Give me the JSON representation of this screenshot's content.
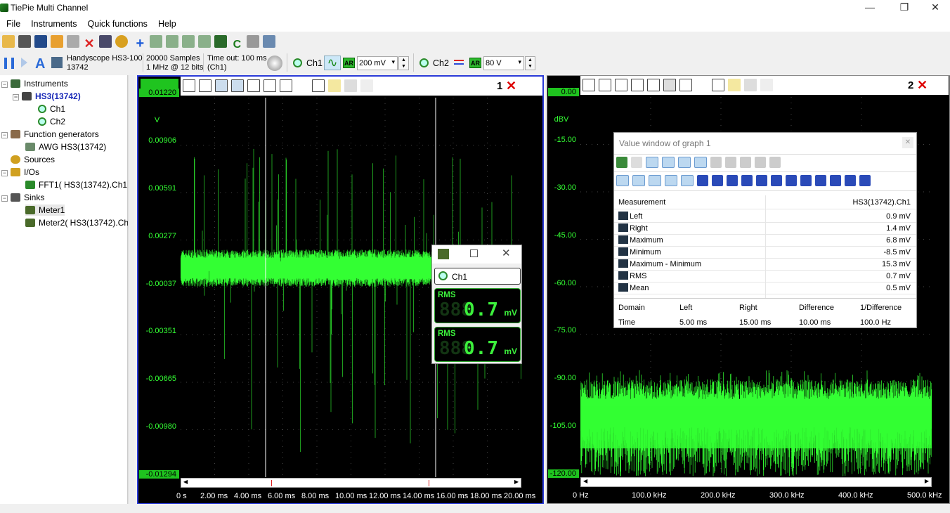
{
  "window": {
    "title": "TiePie Multi Channel",
    "min": "—",
    "max": "❐",
    "close": "✕"
  },
  "menu": [
    "File",
    "Instruments",
    "Quick functions",
    "Help"
  ],
  "toolbar2": {
    "instrument_line1": "Handyscope HS3-100",
    "instrument_line2": "13742",
    "samples_line1": "20000 Samples",
    "samples_line2": "1 MHz @ 12 bits",
    "timeout_line1": "Time out: 100 ms",
    "timeout_line2": "(Ch1)",
    "ch1_label": "Ch1",
    "ch1_range": "200 mV",
    "ch2_label": "Ch2",
    "ch2_range": "80 V",
    "ar": "AR"
  },
  "tree": {
    "instruments": "Instruments",
    "device": "HS3(13742)",
    "ch1": "Ch1",
    "ch2": "Ch2",
    "function_generators": "Function generators",
    "awg": "AWG HS3(13742)",
    "sources": "Sources",
    "ios": "I/Os",
    "fft": "FFT1( HS3(13742).Ch1 )",
    "sinks": "Sinks",
    "meter1": "Meter1",
    "meter2": "Meter2( HS3(13742).Ch1"
  },
  "graph1": {
    "number": "1",
    "unit": "V",
    "y_labels": [
      "0.01220",
      "0.00906",
      "0.00591",
      "0.00277",
      "-0.00037",
      "-0.00351",
      "-0.00665",
      "-0.00980",
      "-0.01294"
    ],
    "x_labels": [
      "0 s",
      "2.00 ms",
      "4.00 ms",
      "6.00 ms",
      "8.00 ms",
      "10.00 ms",
      "12.00 ms",
      "14.00 ms",
      "16.00 ms",
      "18.00 ms",
      "20.00 ms"
    ]
  },
  "graph2": {
    "number": "2",
    "unit": "dBV",
    "y_labels": [
      "0.00",
      "-15.00",
      "-30.00",
      "-45.00",
      "-60.00",
      "-75.00",
      "-90.00",
      "-105.00",
      "-120.00"
    ],
    "x_labels": [
      "0 Hz",
      "100.0 kHz",
      "200.0 kHz",
      "300.0 kHz",
      "400.0 kHz",
      "500.0 kHz"
    ]
  },
  "meter": {
    "channel": "Ch1",
    "rows": [
      {
        "label": "RMS",
        "ghost": "888",
        "value": "0.7",
        "unit": "mV"
      },
      {
        "label": "RMS",
        "ghost": "888",
        "value": "0.7",
        "unit": "mV"
      }
    ]
  },
  "value_window": {
    "title": "Value window of graph 1",
    "header_label": "Measurement",
    "header_value": "HS3(13742).Ch1",
    "measurements": [
      {
        "label": "Left",
        "value": "0.9 mV",
        "icon": "left-cursor-icon"
      },
      {
        "label": "Right",
        "value": "1.4 mV",
        "icon": "right-cursor-icon"
      },
      {
        "label": "Maximum",
        "value": "6.8 mV",
        "icon": "maximum-icon"
      },
      {
        "label": "Minimum",
        "value": "-8.5 mV",
        "icon": "minimum-icon"
      },
      {
        "label": "Maximum - Minimum",
        "value": "15.3 mV",
        "icon": "peak-to-peak-icon"
      },
      {
        "label": "RMS",
        "value": "0.7 mV",
        "icon": "rms-icon"
      },
      {
        "label": "Mean",
        "value": "0.5 mV",
        "icon": "mean-icon"
      }
    ],
    "domain_headers": [
      "Domain",
      "Left",
      "Right",
      "Difference",
      "1/Difference"
    ],
    "domain_values": [
      "Time",
      "5.00 ms",
      "15.00 ms",
      "10.00 ms",
      "100.0 Hz"
    ]
  },
  "colors": {
    "trace": "#33ff33",
    "accent": "#1fc41f",
    "graph_bg": "#000000",
    "axis_text": "#33ff33"
  }
}
